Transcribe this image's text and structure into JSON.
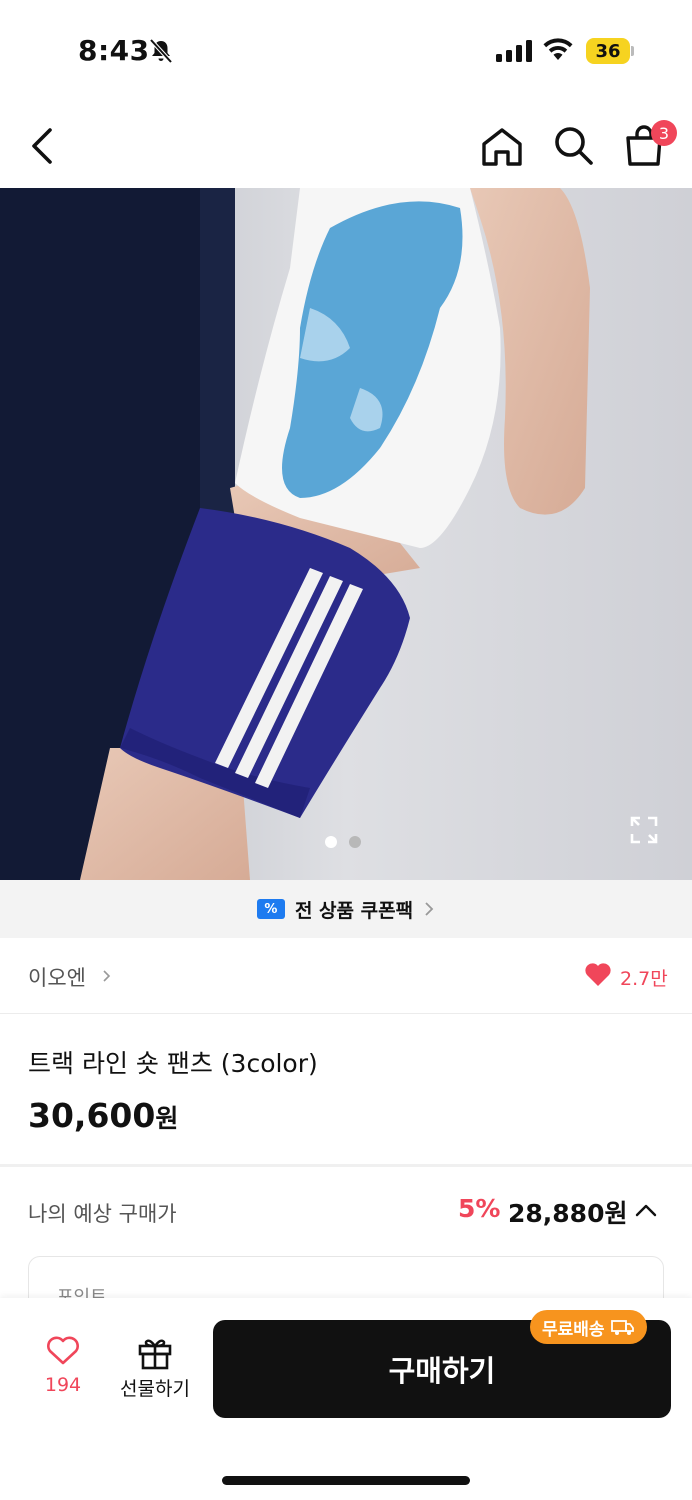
{
  "status_bar": {
    "time": "8:43",
    "battery": "36"
  },
  "nav": {
    "cart_count": "3"
  },
  "hero": {
    "image_count": 2,
    "active_index": 0,
    "expand_icon": "expand-icon"
  },
  "coupon": {
    "icon_text": "%",
    "label": "전 상품 쿠폰팩"
  },
  "brand": {
    "name": "이오엔",
    "likes": "2.7만"
  },
  "product": {
    "title": "트랙 라인 숏 팬츠 (3color)",
    "price": "30,600",
    "currency": "원"
  },
  "estimate": {
    "label": "나의 예상 구매가",
    "discount": "5%",
    "price": "28,880원",
    "point_label": "포인트"
  },
  "bottom": {
    "wish_count": "194",
    "gift_label": "선물하기",
    "buy_label": "구매하기",
    "free_ship_label": "무료배송"
  },
  "colors": {
    "accent_red": "#f0465a",
    "coupon_blue": "#1e7bf0",
    "badge_orange": "#f7941e",
    "battery_yellow": "#f6d320"
  }
}
